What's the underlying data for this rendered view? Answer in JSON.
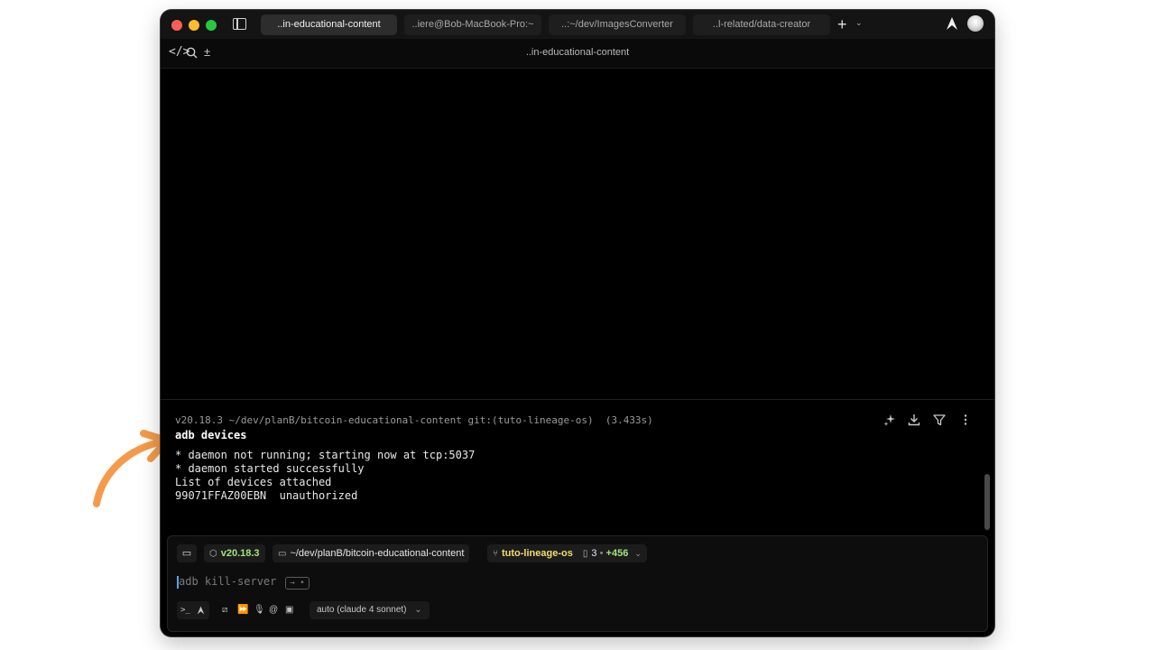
{
  "tabs": [
    {
      "label": "..in-educational-content",
      "active": true
    },
    {
      "label": "..iere@Bob-MacBook-Pro:~",
      "active": false
    },
    {
      "label": "..:~/dev/ImagesConverter",
      "active": false
    },
    {
      "label": "..l-related/data-creator",
      "active": false
    }
  ],
  "toolbar": {
    "title": "..in-educational-content",
    "icons": [
      "code-icon",
      "search-icon",
      "plus-minus-icon"
    ]
  },
  "block": {
    "header": "v20.18.3 ~/dev/planB/bitcoin-educational-content git:(tuto-lineage-os)  (3.433s)",
    "command": "adb devices",
    "output": [
      "* daemon not running; starting now at tcp:5037",
      "* daemon started successfully",
      "List of devices attached",
      "99071FFAZ00EBN  unauthorized"
    ],
    "actions": [
      "sparkle-icon",
      "download-icon",
      "filter-icon",
      "more-icon"
    ]
  },
  "input": {
    "node_version": "v20.18.3",
    "path": "~/dev/planB/bitcoin-educational-content",
    "branch": "tuto-lineage-os",
    "changed_files": "3",
    "separator": "•",
    "additions": "+456",
    "placeholder": "adb kill-server",
    "key_hint": "→ •",
    "model": "auto (claude 4 sonnet)"
  },
  "colors": {
    "background": "#000000",
    "accent_green": "#a7e07d",
    "arrow_orange": "#f59a4a",
    "caret_blue": "#56a8f5"
  }
}
